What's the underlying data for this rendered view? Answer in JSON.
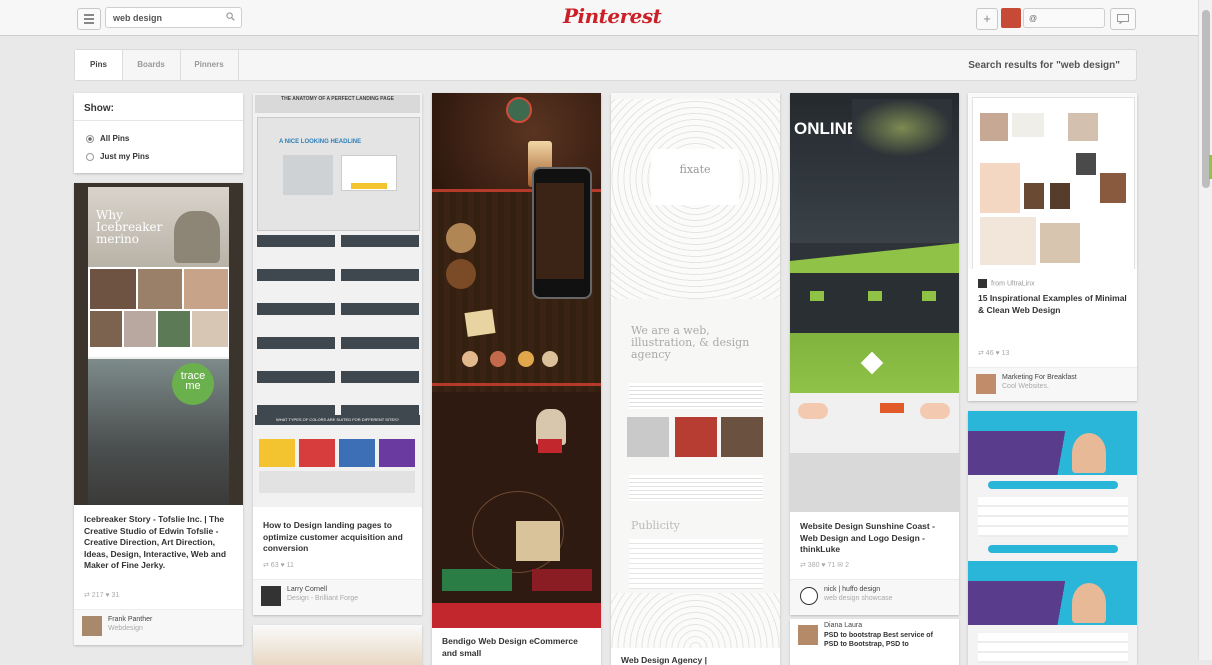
{
  "header": {
    "search_value": "web design",
    "logo_text": "Pinterest",
    "add_label": "+",
    "user_box_text": "@"
  },
  "subnav": {
    "tabs": [
      "Pins",
      "Boards",
      "Pinners"
    ],
    "results_text": "Search results for \"web design\""
  },
  "filter": {
    "title": "Show:",
    "options": [
      "All Pins",
      "Just my Pins"
    ]
  },
  "pins": [
    {
      "title": "Icebreaker Story - Tofslie Inc. | The Creative Studio of Edwin Tofslie - Creative Direction, Art Direction, Ideas, Design, Interactive, Web and Maker of Fine Jerky.",
      "stats": "⇄ 217  ♥ 31",
      "user": "Frank Panther",
      "board": "Webdesign"
    },
    {
      "title": "How to Design landing pages to optimize customer acquisition and conversion",
      "stats": "⇄ 63  ♥ 11",
      "user": "Larry Cornell",
      "board": "Design - Brilliant Forge"
    },
    {
      "title": "Bendigo Web Design eCommerce and small"
    },
    {
      "title": "Web Design Agency |"
    },
    {
      "title": "Website Design Sunshine Coast - Web Design and Logo Design - thinkLuke",
      "stats": "⇄ 380  ♥ 71  ✉ 2",
      "user": "nick | huffo design",
      "board": "web design showcase",
      "user2": "Diana Laura",
      "title2": "PSD to bootstrap Best service of PSD to Bootstrap, PSD to"
    },
    {
      "via": "from UltraLinx",
      "title": "15 Inspirational Examples of Minimal & Clean Web Design",
      "stats": "⇄ 46  ♥ 13",
      "user": "Marketing For Breakfast",
      "board": "Cool Websites."
    }
  ],
  "image_text": {
    "icebreaker_headline": "Why Icebreaker merino",
    "trace_me": "trace me",
    "landing_title": "THE ANATOMY OF A PERFECT LANDING PAGE",
    "landing_headline": "A NICE LOOKING HEADLINE",
    "landing_colors": "WHAT TYPES OF COLORS ARE SUITED FOR DIFFERENT SITES?",
    "fixate_logo": "fixate",
    "fixate_tagline": "We are a web, illustration, & design agency",
    "fixate_publicity": "Publicity",
    "online": "ONLINE"
  },
  "colors": {
    "brand": "#cb2027",
    "page_bg": "#e9e9e9",
    "accent_green": "#8fc247"
  }
}
